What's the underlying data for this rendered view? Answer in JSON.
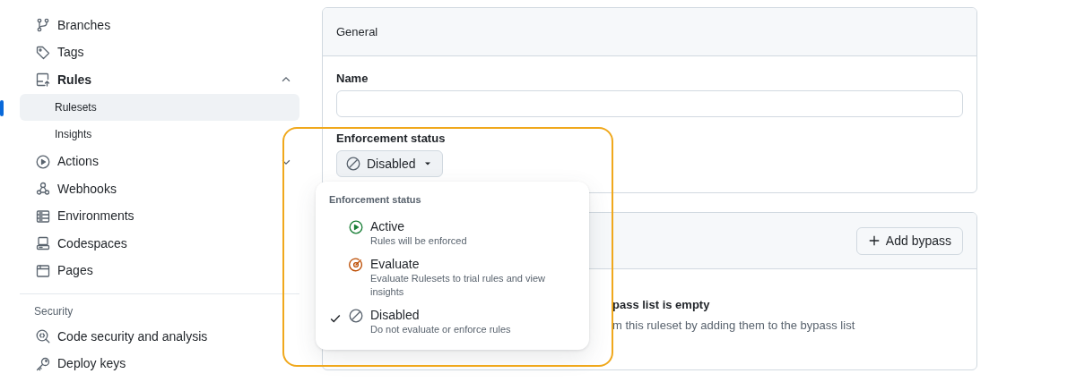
{
  "sidebar": {
    "sections": [
      {
        "items": [
          {
            "label": "Branches",
            "selected": false
          },
          {
            "label": "Tags",
            "selected": false
          },
          {
            "label": "Rules",
            "selected": false,
            "expanded": true,
            "children": [
              {
                "label": "Rulesets",
                "selected": true
              },
              {
                "label": "Insights",
                "selected": false
              }
            ]
          },
          {
            "label": "Actions",
            "selected": false,
            "expanded": false
          },
          {
            "label": "Webhooks",
            "selected": false
          },
          {
            "label": "Environments",
            "selected": false
          },
          {
            "label": "Codespaces",
            "selected": false
          },
          {
            "label": "Pages",
            "selected": false
          }
        ]
      },
      {
        "title": "Security",
        "items": [
          {
            "label": "Code security and analysis",
            "selected": false
          },
          {
            "label": "Deploy keys",
            "selected": false
          }
        ]
      }
    ]
  },
  "general": {
    "title": "General",
    "name_label": "Name",
    "status_label": "Enforcement status",
    "status_button": {
      "label": "Disabled"
    }
  },
  "bypass": {
    "button": "Add bypass",
    "empty_title": "pass list is empty",
    "empty_text": "m this ruleset by adding them to the bypass list"
  },
  "status_menu": {
    "title": "Enforcement status",
    "options": [
      {
        "label": "Active",
        "description": "Rules will be enforced",
        "color": "#1a7f37",
        "selected": false
      },
      {
        "label": "Evaluate",
        "description": "Evaluate Rulesets to trial rules and view insights",
        "color": "#bc4c00",
        "selected": false
      },
      {
        "label": "Disabled",
        "description": "Do not evaluate or enforce rules",
        "color": "#59636e",
        "selected": true
      }
    ]
  }
}
